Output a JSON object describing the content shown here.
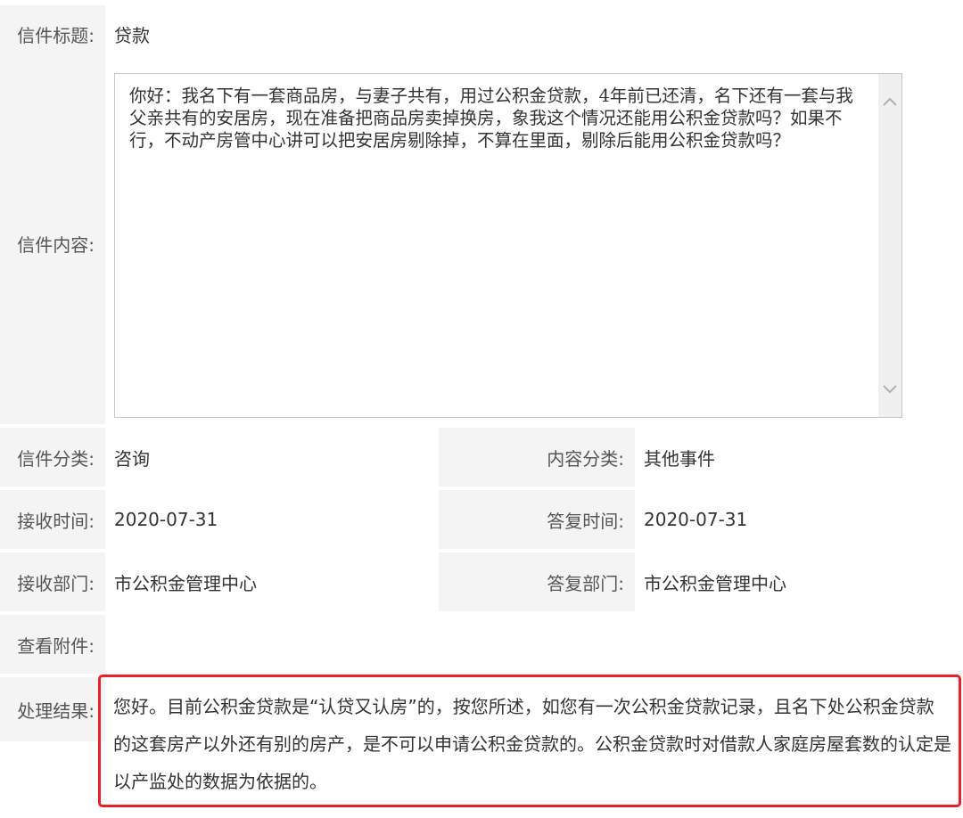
{
  "subject": {
    "label": "信件标题:",
    "value": "贷款"
  },
  "content": {
    "label": "信件内容:",
    "text": "你好：我名下有一套商品房，与妻子共有，用过公积金贷款，4年前已还清，名下还有一套与我父亲共有的安居房，现在准备把商品房卖掉换房，象我这个情况还能用公积金贷款吗？如果不行，不动产房管中心讲可以把安居房剔除掉，不算在里面，剔除后能用公积金贷款吗？"
  },
  "category": {
    "label": "信件分类:",
    "value": "咨询",
    "label2": "内容分类:",
    "value2": "其他事件"
  },
  "time": {
    "label": "接收时间:",
    "value": "2020-07-31",
    "label2": "答复时间:",
    "value2": "2020-07-31"
  },
  "dept": {
    "label": "接收部门:",
    "value": "市公积金管理中心",
    "label2": "答复部门:",
    "value2": "市公积金管理中心"
  },
  "attachment": {
    "label": "查看附件:"
  },
  "result": {
    "label": "处理结果:",
    "text": "您好。目前公积金贷款是“认贷又认房”的，按您所述，如您有一次公积金贷款记录，且名下处公积金贷款的这套房产以外还有别的房产，是不可以申请公积金贷款的。公积金贷款时对借款人家庭房屋套数的认定是以产监处的数据为依据的。"
  },
  "highlight_color": "#e8202a"
}
